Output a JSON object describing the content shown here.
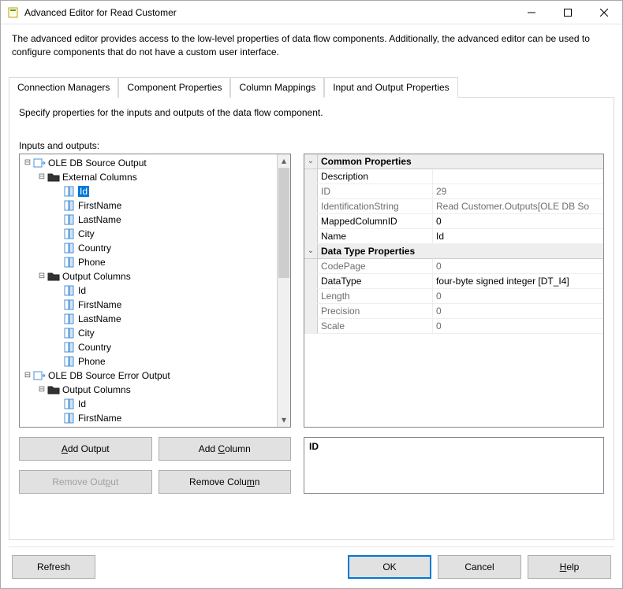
{
  "window": {
    "title": "Advanced Editor for Read Customer"
  },
  "description": "The advanced editor provides access to the low-level properties of data flow components. Additionally, the advanced editor can be used to configure components that do not have a custom user interface.",
  "tabs": [
    {
      "label": "Connection Managers"
    },
    {
      "label": "Component Properties"
    },
    {
      "label": "Column Mappings"
    },
    {
      "label": "Input and Output Properties"
    }
  ],
  "instruction": "Specify properties for the inputs and outputs of the data flow component.",
  "io_label": "Inputs and outputs:",
  "tree": {
    "node1": "OLE DB Source Output",
    "node1a": "External Columns",
    "node1a_items": [
      "Id",
      "FirstName",
      "LastName",
      "City",
      "Country",
      "Phone"
    ],
    "node1b": "Output Columns",
    "node1b_items": [
      "Id",
      "FirstName",
      "LastName",
      "City",
      "Country",
      "Phone"
    ],
    "node2": "OLE DB Source Error Output",
    "node2a": "Output Columns",
    "node2a_items": [
      "Id",
      "FirstName"
    ]
  },
  "buttons": {
    "add_output": "Add Output",
    "add_column": "Add Column",
    "remove_output": "Remove Output",
    "remove_column": "Remove Column",
    "refresh": "Refresh",
    "ok": "OK",
    "cancel": "Cancel",
    "help": "Help"
  },
  "prop_categories": {
    "common": "Common Properties",
    "datatype": "Data Type Properties"
  },
  "props": {
    "Description": {
      "name": "Description",
      "value": ""
    },
    "ID": {
      "name": "ID",
      "value": "29"
    },
    "IdentificationString": {
      "name": "IdentificationString",
      "value": "Read Customer.Outputs[OLE DB So"
    },
    "MappedColumnID": {
      "name": "MappedColumnID",
      "value": "0"
    },
    "Name": {
      "name": "Name",
      "value": "Id"
    },
    "CodePage": {
      "name": "CodePage",
      "value": "0"
    },
    "DataType": {
      "name": "DataType",
      "value": "four-byte signed integer [DT_I4]"
    },
    "Length": {
      "name": "Length",
      "value": "0"
    },
    "Precision": {
      "name": "Precision",
      "value": "0"
    },
    "Scale": {
      "name": "Scale",
      "value": "0"
    }
  },
  "prop_detail": "ID"
}
